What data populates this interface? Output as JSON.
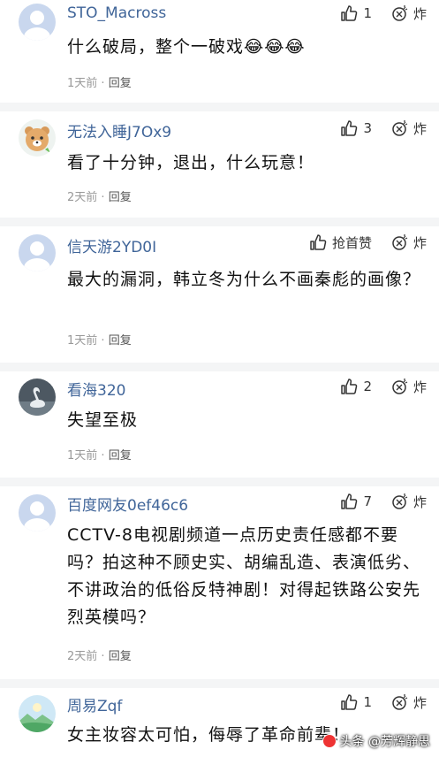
{
  "comments": [
    {
      "username": "STO_Macross",
      "avatar": "default-avatar-icon",
      "likes": "1",
      "dislike_label": "炸",
      "text": "什么破局，整个一破戏😂😂😂",
      "time": "1天前",
      "separator": "·",
      "reply": "回复"
    },
    {
      "username": "无法入睡J7Ox9",
      "avatar": "bear-avatar-icon",
      "likes": "3",
      "dislike_label": "炸",
      "text": "看了十分钟，退出，什么玩意！",
      "time": "2天前",
      "separator": "·",
      "reply": "回复"
    },
    {
      "username": "信天游2YD0I",
      "avatar": "default-avatar-icon",
      "likes": "抢首赞",
      "dislike_label": "炸",
      "text": "最大的漏洞，韩立冬为什么不画秦彪的画像？",
      "time": "1天前",
      "separator": "·",
      "reply": "回复"
    },
    {
      "username": "看海320",
      "avatar": "swan-avatar-icon",
      "likes": "2",
      "dislike_label": "炸",
      "text": "失望至极",
      "time": "1天前",
      "separator": "·",
      "reply": "回复"
    },
    {
      "username": "百度网友0ef46c6",
      "avatar": "default-avatar-icon",
      "likes": "7",
      "dislike_label": "炸",
      "text": "CCTV-8电视剧频道一点历史责任感都不要吗？拍这种不顾史实、胡编乱造、表演低劣、不讲政治的低俗反特神剧！对得起铁路公安先烈英模吗？",
      "time": "2天前",
      "separator": "·",
      "reply": "回复"
    },
    {
      "username": "周易Zqf",
      "avatar": "landscape-avatar-icon",
      "likes": "1",
      "dislike_label": "炸",
      "text": "女主妆容太可怕，侮辱了革命前辈！",
      "time": "",
      "separator": "",
      "reply": ""
    }
  ],
  "watermark": "头条 @芳辉静思",
  "colors": {
    "username": "#406599",
    "divider": "#f4f5f6",
    "meta": "#999999"
  }
}
